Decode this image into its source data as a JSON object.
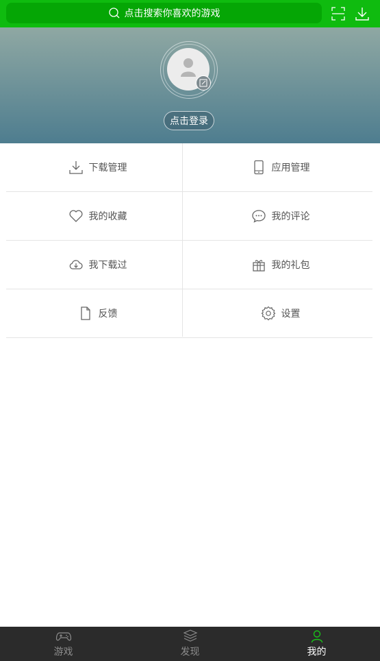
{
  "search": {
    "placeholder": "点击搜索你喜欢的游戏"
  },
  "profile": {
    "login_label": "点击登录"
  },
  "menu": [
    {
      "left": {
        "label": "下载管理",
        "icon": "download-icon"
      },
      "right": {
        "label": "应用管理",
        "icon": "phone-icon"
      }
    },
    {
      "left": {
        "label": "我的收藏",
        "icon": "heart-icon"
      },
      "right": {
        "label": "我的评论",
        "icon": "comment-icon"
      }
    },
    {
      "left": {
        "label": "我下载过",
        "icon": "cloud-download-icon"
      },
      "right": {
        "label": "我的礼包",
        "icon": "gift-icon"
      }
    },
    {
      "left": {
        "label": "反馈",
        "icon": "document-icon"
      },
      "right": {
        "label": "设置",
        "icon": "gear-icon"
      }
    }
  ],
  "tabs": [
    {
      "label": "游戏",
      "icon": "gamepad-icon",
      "active": false
    },
    {
      "label": "发现",
      "icon": "cube-icon",
      "active": false
    },
    {
      "label": "我的",
      "icon": "person-icon",
      "active": true
    }
  ],
  "colors": {
    "brand": "#0fbb0f",
    "active_tab": "#19c219",
    "tabbar": "#2b2b2b"
  }
}
